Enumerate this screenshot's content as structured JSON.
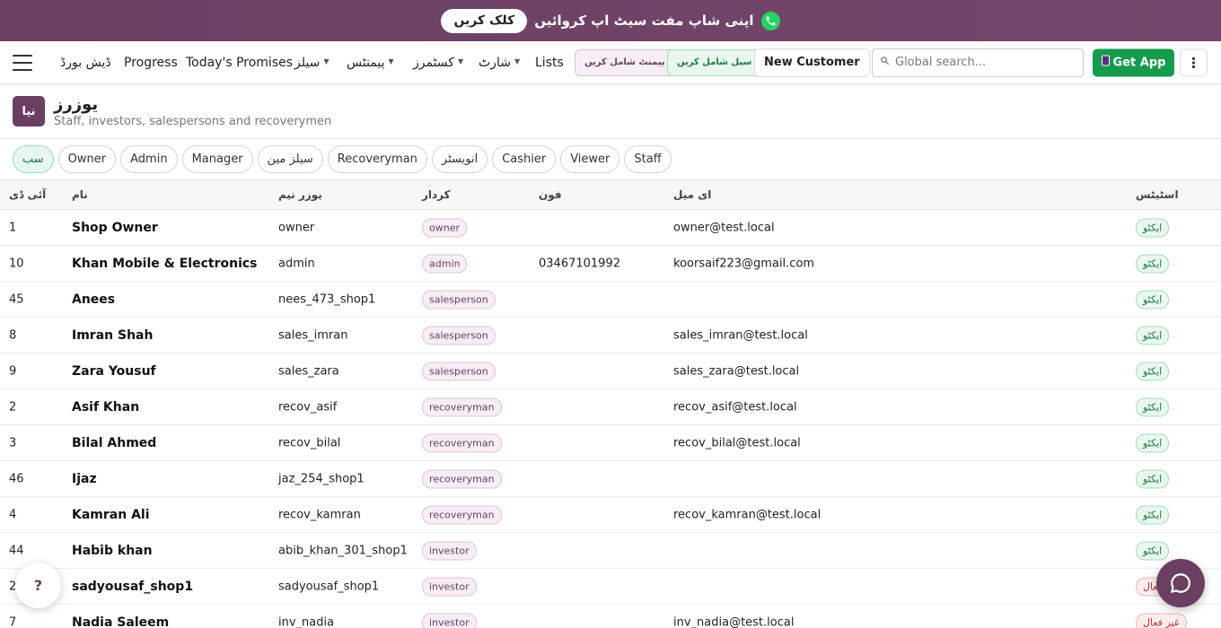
{
  "promo": {
    "text": "اپنی شاپ مفت سیٹ اپ کروائیں",
    "button": "کلک کریں",
    "icon": "whatsapp-icon"
  },
  "nav": {
    "links": [
      "ڈیش بورڈ",
      "Progress",
      "Today's Promises"
    ],
    "dropdowns": [
      "سیلز",
      "پیمنٹس",
      "کسٹمرز",
      "شارٹ"
    ],
    "lists": "Lists",
    "add_payment": "پیمنٹ شامل کریں",
    "add_sale": "سیل شامل کریں",
    "new_customer": "New Customer",
    "search_placeholder": "Global search...",
    "get_app": "Get App",
    "more": "⋮"
  },
  "header": {
    "new_button": "نیا",
    "title": "یوزرز",
    "subtitle": "Staff, investors, salespersons and recoverymen"
  },
  "filters": [
    "سب",
    "Owner",
    "Admin",
    "Manager",
    "سیلز مین",
    "Recoveryman",
    "انویسٹر",
    "Cashier",
    "Viewer",
    "Staff"
  ],
  "columns": {
    "id": "آئی ڈی",
    "name": "نام",
    "username": "یوزر نیم",
    "role": "کردار",
    "phone": "فون",
    "email": "ای میل",
    "status": "اسٹیٹس"
  },
  "users": [
    {
      "id": "1",
      "name": "Shop Owner",
      "username": "owner",
      "role": "owner",
      "phone": "",
      "email": "owner@test.local",
      "status": "ایکٹو"
    },
    {
      "id": "10",
      "name": "Khan Mobile & Electronics",
      "username": "admin",
      "role": "admin",
      "phone": "03467101992",
      "email": "koorsaif223@gmail.com",
      "status": "ایکٹو"
    },
    {
      "id": "45",
      "name": "Anees",
      "username": "nees_473_shop1",
      "role": "salesperson",
      "phone": "",
      "email": "",
      "status": "ایکٹو"
    },
    {
      "id": "8",
      "name": "Imran Shah",
      "username": "sales_imran",
      "role": "salesperson",
      "phone": "",
      "email": "sales_imran@test.local",
      "status": "ایکٹو"
    },
    {
      "id": "9",
      "name": "Zara Yousuf",
      "username": "sales_zara",
      "role": "salesperson",
      "phone": "",
      "email": "sales_zara@test.local",
      "status": "ایکٹو"
    },
    {
      "id": "2",
      "name": "Asif Khan",
      "username": "recov_asif",
      "role": "recoveryman",
      "phone": "",
      "email": "recov_asif@test.local",
      "status": "ایکٹو"
    },
    {
      "id": "3",
      "name": "Bilal Ahmed",
      "username": "recov_bilal",
      "role": "recoveryman",
      "phone": "",
      "email": "recov_bilal@test.local",
      "status": "ایکٹو"
    },
    {
      "id": "46",
      "name": "Ijaz",
      "username": "jaz_254_shop1",
      "role": "recoveryman",
      "phone": "",
      "email": "",
      "status": "ایکٹو"
    },
    {
      "id": "4",
      "name": "Kamran Ali",
      "username": "recov_kamran",
      "role": "recoveryman",
      "phone": "",
      "email": "recov_kamran@test.local",
      "status": "ایکٹو"
    },
    {
      "id": "44",
      "name": "Habib khan",
      "username": "abib_khan_301_shop1",
      "role": "investor",
      "phone": "",
      "email": "",
      "status": "ایکٹو"
    },
    {
      "id": "24",
      "name": "sadyousaf_shop1",
      "username": "sadyousaf_shop1",
      "role": "investor",
      "phone": "",
      "email": "",
      "status": "غیر فعال"
    },
    {
      "id": "7",
      "name": "Nadia Saleem",
      "username": "inv_nadia",
      "role": "investor",
      "phone": "",
      "email": "inv_nadia@test.local",
      "status": "غیر فعال"
    }
  ],
  "fab": {
    "help": "?"
  },
  "colors": {
    "brand": "#6b3f62",
    "accent_green": "#169a4c",
    "active": "#1d7a44",
    "inactive": "#b33a32"
  }
}
